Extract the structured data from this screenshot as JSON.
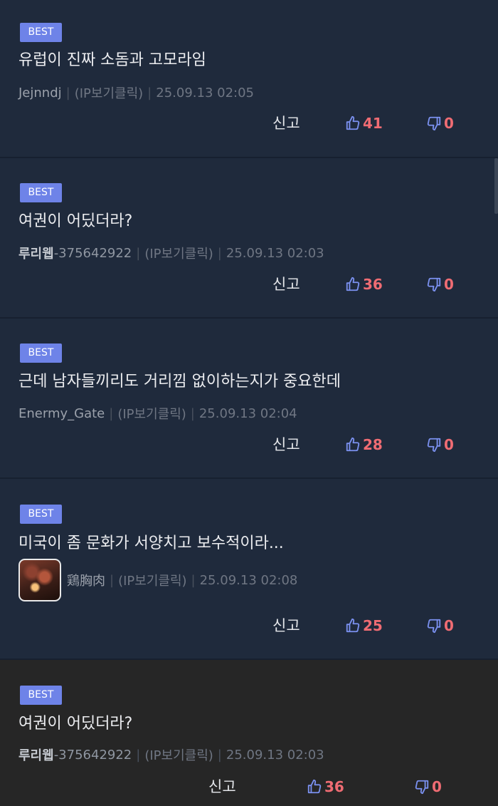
{
  "comments": [
    {
      "badge": "BEST",
      "text": "유럽이 진짜 소돔과 고모라임",
      "author": "Jejnndj",
      "author_suffix": "",
      "ip": "(IP보기클릭)",
      "time": "25.09.13 02:05",
      "report": "신고",
      "likes": "41",
      "dislikes": "0"
    },
    {
      "badge": "BEST",
      "text": "여권이 어딨더라?",
      "author": "루리웹",
      "author_suffix": "-375642922",
      "ip": "(IP보기클릭)",
      "time": "25.09.13 02:03",
      "report": "신고",
      "likes": "36",
      "dislikes": "0"
    },
    {
      "badge": "BEST",
      "text": "근데 남자들끼리도 거리낌 없이하는지가 중요한데",
      "author": "Enermy_Gate",
      "author_suffix": "",
      "ip": "(IP보기클릭)",
      "time": "25.09.13 02:04",
      "report": "신고",
      "likes": "28",
      "dislikes": "0"
    },
    {
      "badge": "BEST",
      "text": "미국이 좀 문화가 서양치고 보수적이라...",
      "author": "鶏胸肉",
      "author_suffix": "",
      "ip": "(IP보기클릭)",
      "time": "25.09.13 02:08",
      "report": "신고",
      "likes": "25",
      "dislikes": "0"
    },
    {
      "badge": "BEST",
      "text": "여권이 어딨더라?",
      "author": "루리웹",
      "author_suffix": "-375642922",
      "ip": "(IP보기클릭)",
      "time": "25.09.13 02:03",
      "report": "신고",
      "likes": "36",
      "dislikes": "0"
    }
  ],
  "colors": {
    "background": "#1f2a3c",
    "badge": "#6e83e8",
    "thumb_icon": "#7b91f0",
    "count": "#ef6c73"
  },
  "icons": {
    "like": "thumbs-up-icon",
    "dislike": "thumbs-down-icon"
  }
}
